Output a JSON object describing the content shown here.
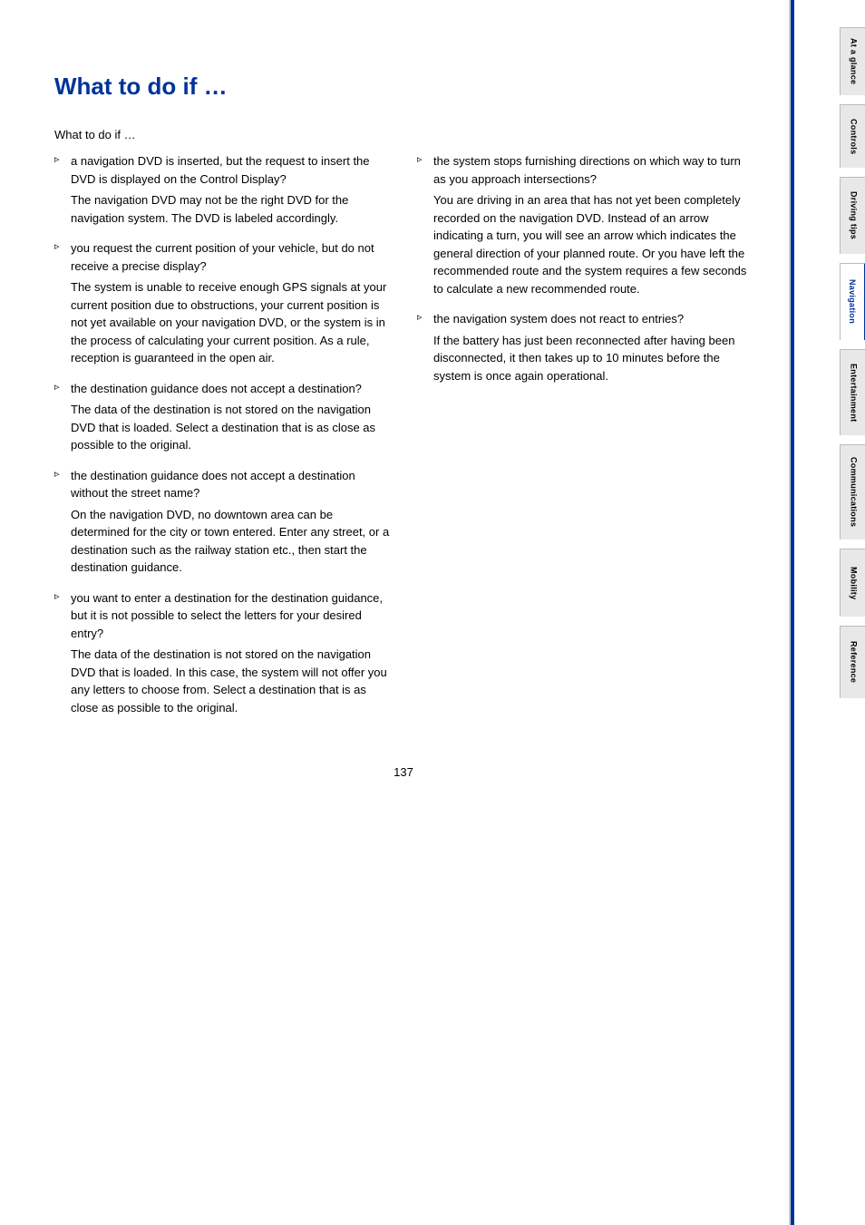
{
  "page": {
    "title": "What to do if …",
    "page_number": "137"
  },
  "intro": {
    "text": "What to do if …"
  },
  "left_column": [
    {
      "question": "a navigation DVD is inserted, but the request to insert the DVD is displayed on the Control Display?",
      "answer": "The navigation DVD may not be the right DVD for the navigation system. The DVD is labeled accordingly."
    },
    {
      "question": "you request the current position of your vehicle, but do not receive a precise display?",
      "answer": "The system is unable to receive enough GPS signals at your current position due to obstructions, your current position is not yet available on your navigation DVD, or the system is in the process of calculating your current position. As a rule, reception is guaranteed in the open air."
    },
    {
      "question": "the destination guidance does not accept a destination?",
      "answer": "The data of the destination is not stored on the navigation DVD that is loaded. Select a destination that is as close as possible to the original."
    },
    {
      "question": "the destination guidance does not accept a destination without the street name?",
      "answer": "On the navigation DVD, no downtown area can be determined for the city or town entered. Enter any street, or a destination such as the railway station etc., then start the destination guidance."
    },
    {
      "question": "you want to enter a destination for the destination guidance, but it is not possible to select the letters for your desired entry?",
      "answer": "The data of the destination is not stored on the navigation DVD that is loaded. In this case, the system will not offer you any letters to choose from. Select a destination that is as close as possible to the original."
    }
  ],
  "right_column": [
    {
      "question": "the system stops furnishing directions on which way to turn as you approach intersections?",
      "answer": "You are driving in an area that has not yet been completely recorded on the navigation DVD. Instead of an arrow indicating a turn, you will see an arrow which indicates the general direction of your planned route. Or you have left the recommended route and the system requires a few seconds to calculate a new recommended route."
    },
    {
      "question": "the navigation system does not react to entries?",
      "answer": "If the battery has just been reconnected after having been disconnected, it then takes up to 10 minutes before the system is once again operational."
    }
  ],
  "sidebar": {
    "tabs": [
      {
        "label": "At a glance",
        "active": false
      },
      {
        "label": "Controls",
        "active": false
      },
      {
        "label": "Driving tips",
        "active": false
      },
      {
        "label": "Navigation",
        "active": true
      },
      {
        "label": "Entertainment",
        "active": false
      },
      {
        "label": "Communications",
        "active": false
      },
      {
        "label": "Mobility",
        "active": false
      },
      {
        "label": "Reference",
        "active": false
      }
    ]
  }
}
